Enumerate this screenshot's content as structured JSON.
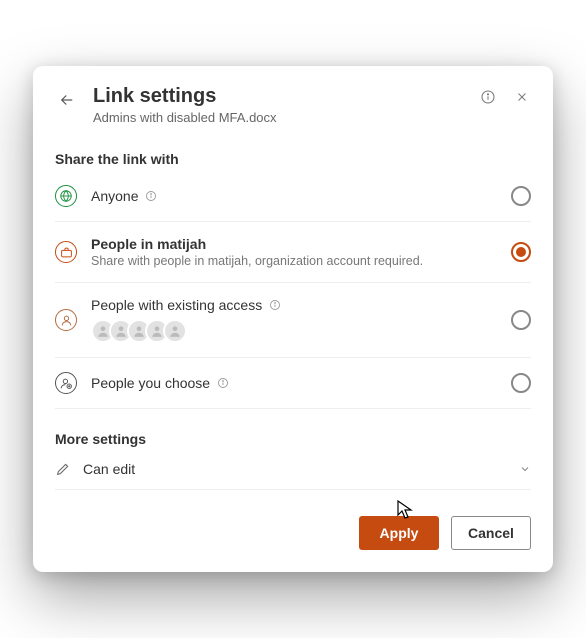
{
  "header": {
    "title": "Link settings",
    "subtitle": "Admins with disabled MFA.docx"
  },
  "share_section_label": "Share the link with",
  "options": {
    "anyone": {
      "label": "Anyone"
    },
    "org": {
      "label": "People in matijah",
      "desc": "Share with people in matijah, organization account required."
    },
    "existing": {
      "label": "People with existing access"
    },
    "specific": {
      "label": "People you choose"
    }
  },
  "more_settings_label": "More settings",
  "permission": {
    "label": "Can edit"
  },
  "buttons": {
    "apply": "Apply",
    "cancel": "Cancel"
  }
}
